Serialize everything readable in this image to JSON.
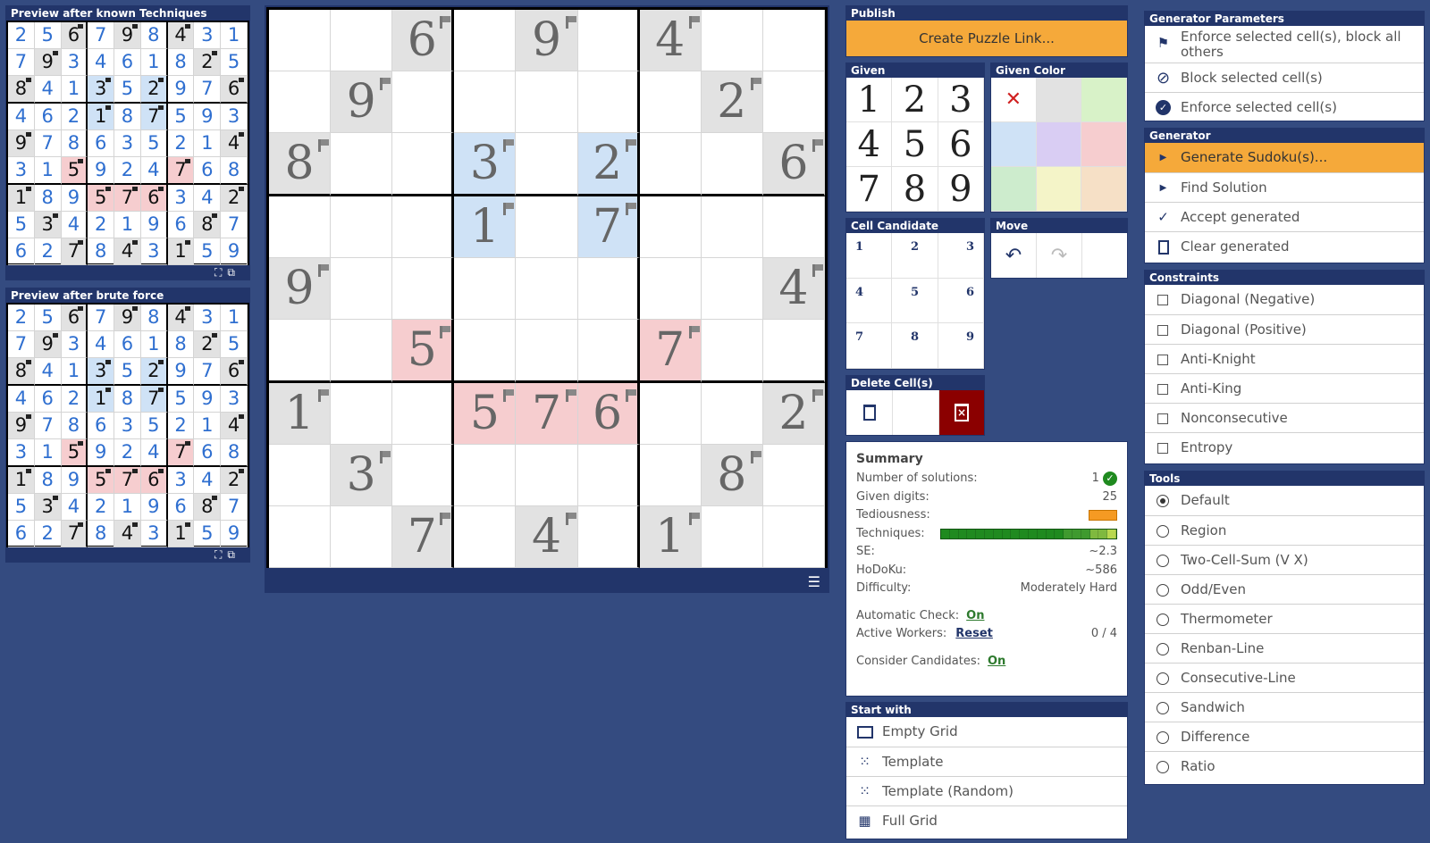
{
  "preview_known": {
    "title": "Preview after known Techniques",
    "rows": [
      [
        "2",
        "5",
        "6",
        "7",
        "9",
        "8",
        "4",
        "3",
        "1"
      ],
      [
        "7",
        "9",
        "3",
        "4",
        "6",
        "1",
        "8",
        "2",
        "5"
      ],
      [
        "8",
        "4",
        "1",
        "3",
        "5",
        "2",
        "9",
        "7",
        "6"
      ],
      [
        "4",
        "6",
        "2",
        "1",
        "8",
        "7",
        "5",
        "9",
        "3"
      ],
      [
        "9",
        "7",
        "8",
        "6",
        "3",
        "5",
        "2",
        "1",
        "4"
      ],
      [
        "3",
        "1",
        "5",
        "9",
        "2",
        "4",
        "7",
        "6",
        "8"
      ],
      [
        "1",
        "8",
        "9",
        "5",
        "7",
        "6",
        "3",
        "4",
        "2"
      ],
      [
        "5",
        "3",
        "4",
        "2",
        "1",
        "9",
        "6",
        "8",
        "7"
      ],
      [
        "6",
        "2",
        "7",
        "8",
        "4",
        "3",
        "1",
        "5",
        "9"
      ]
    ]
  },
  "preview_brute": {
    "title": "Preview after brute force",
    "rows": [
      [
        "2",
        "5",
        "6",
        "7",
        "9",
        "8",
        "4",
        "3",
        "1"
      ],
      [
        "7",
        "9",
        "3",
        "4",
        "6",
        "1",
        "8",
        "2",
        "5"
      ],
      [
        "8",
        "4",
        "1",
        "3",
        "5",
        "2",
        "9",
        "7",
        "6"
      ],
      [
        "4",
        "6",
        "2",
        "1",
        "8",
        "7",
        "5",
        "9",
        "3"
      ],
      [
        "9",
        "7",
        "8",
        "6",
        "3",
        "5",
        "2",
        "1",
        "4"
      ],
      [
        "3",
        "1",
        "5",
        "9",
        "2",
        "4",
        "7",
        "6",
        "8"
      ],
      [
        "1",
        "8",
        "9",
        "5",
        "7",
        "6",
        "3",
        "4",
        "2"
      ],
      [
        "5",
        "3",
        "4",
        "2",
        "1",
        "9",
        "6",
        "8",
        "7"
      ],
      [
        "6",
        "2",
        "7",
        "8",
        "4",
        "3",
        "1",
        "5",
        "9"
      ]
    ]
  },
  "grid": {
    "givens": [
      [
        "",
        "",
        "6",
        "",
        "9",
        "",
        "4",
        "",
        ""
      ],
      [
        "",
        "9",
        "",
        "",
        "",
        "",
        "",
        "2",
        ""
      ],
      [
        "8",
        "",
        "",
        "3",
        "",
        "2",
        "",
        "",
        "6"
      ],
      [
        "",
        "",
        "",
        "1",
        "",
        "7",
        "",
        "",
        ""
      ],
      [
        "9",
        "",
        "",
        "",
        "",
        "",
        "",
        "",
        "4"
      ],
      [
        "",
        "",
        "5",
        "",
        "",
        "",
        "7",
        "",
        ""
      ],
      [
        "1",
        "",
        "",
        "5",
        "7",
        "6",
        "",
        "",
        "2"
      ],
      [
        "",
        "3",
        "",
        "",
        "",
        "",
        "",
        "8",
        ""
      ],
      [
        "",
        "",
        "7",
        "",
        "4",
        "",
        "1",
        "",
        ""
      ]
    ],
    "colors": [
      [
        "w",
        "w",
        "g",
        "w",
        "g",
        "w",
        "g",
        "w",
        "w"
      ],
      [
        "w",
        "g",
        "w",
        "w",
        "w",
        "w",
        "w",
        "g",
        "w"
      ],
      [
        "g",
        "w",
        "w",
        "b",
        "w",
        "b",
        "w",
        "w",
        "g"
      ],
      [
        "w",
        "w",
        "w",
        "b",
        "w",
        "b",
        "w",
        "w",
        "w"
      ],
      [
        "g",
        "w",
        "w",
        "w",
        "w",
        "w",
        "w",
        "w",
        "g"
      ],
      [
        "w",
        "w",
        "r",
        "w",
        "w",
        "w",
        "r",
        "w",
        "w"
      ],
      [
        "g",
        "w",
        "w",
        "r",
        "r",
        "r",
        "w",
        "w",
        "g"
      ],
      [
        "w",
        "g",
        "w",
        "w",
        "w",
        "w",
        "w",
        "g",
        "w"
      ],
      [
        "w",
        "w",
        "g",
        "w",
        "g",
        "w",
        "g",
        "w",
        "w"
      ]
    ],
    "menu_icon": "hamburger-icon"
  },
  "publish": {
    "title": "Publish",
    "button": "Create Puzzle Link..."
  },
  "given": {
    "title": "Given",
    "digits": [
      "1",
      "2",
      "3",
      "4",
      "5",
      "6",
      "7",
      "8",
      "9"
    ]
  },
  "given_color": {
    "title": "Given Color",
    "colors": [
      "#ffffff",
      "#e2e2e2",
      "#d8f2c8",
      "#cfe2f6",
      "#d9cdf3",
      "#f6cdcf",
      "#cdeccd",
      "#f4f4c8",
      "#f6e0c6"
    ]
  },
  "cell_candidate": {
    "title": "Cell Candidate",
    "digits": [
      "1",
      "2",
      "3",
      "4",
      "5",
      "6",
      "7",
      "8",
      "9"
    ]
  },
  "move": {
    "title": "Move"
  },
  "delete": {
    "title": "Delete Cell(s)"
  },
  "summary": {
    "title": "Summary",
    "rows": [
      {
        "label": "Number of solutions:",
        "value": "1"
      },
      {
        "label": "Given digits:",
        "value": "25"
      },
      {
        "label": "Tediousness:",
        "value": ""
      },
      {
        "label": "Techniques:",
        "value": ""
      },
      {
        "label": "SE:",
        "value": "~2.3"
      },
      {
        "label": "HoDoKu:",
        "value": "~586"
      },
      {
        "label": "Difficulty:",
        "value": "Moderately Hard"
      }
    ],
    "auto_check_label": "Automatic Check:",
    "auto_check_value": "On",
    "workers_label": "Active Workers:",
    "workers_link": "Reset",
    "workers_value": "0 / 4",
    "consider_label": "Consider Candidates:",
    "consider_value": "On",
    "tediousness_color": "#f59a23",
    "technique_colors": [
      "#1f8a1f",
      "#1f8a1f",
      "#1f8a1f",
      "#1f8a1f",
      "#1f8a1f",
      "#1f8a1f",
      "#1f8a1f",
      "#1f8a1f",
      "#1f8a1f",
      "#1f8a1f",
      "#1f8a1f",
      "#1f8a1f",
      "#1f8a1f",
      "#1f8a1f",
      "#3f9a2f",
      "#3f9a2f",
      "#3f9a2f",
      "#7fb93f",
      "#7fb93f",
      "#b9d84f"
    ]
  },
  "start_with": {
    "title": "Start with",
    "items": [
      "Empty Grid",
      "Template",
      "Template (Random)",
      "Full Grid"
    ]
  },
  "generator_params": {
    "title": "Generator Parameters",
    "items": [
      "Enforce selected cell(s), block all others",
      "Block selected cell(s)",
      "Enforce selected cell(s)"
    ]
  },
  "generator": {
    "title": "Generator",
    "items": [
      "Generate Sudoku(s)...",
      "Find Solution",
      "Accept generated",
      "Clear generated"
    ]
  },
  "constraints": {
    "title": "Constraints",
    "items": [
      "Diagonal (Negative)",
      "Diagonal (Positive)",
      "Anti-Knight",
      "Anti-King",
      "Nonconsecutive",
      "Entropy"
    ]
  },
  "tools": {
    "title": "Tools",
    "items": [
      "Default",
      "Region",
      "Two-Cell-Sum (V X)",
      "Odd/Even",
      "Thermometer",
      "Renban-Line",
      "Consecutive-Line",
      "Sandwich",
      "Difference",
      "Ratio"
    ],
    "selected": 0
  },
  "colors": {
    "accent": "#f5a93a",
    "header": "#22356a",
    "background": "#344b80",
    "danger": "#8b0000"
  }
}
